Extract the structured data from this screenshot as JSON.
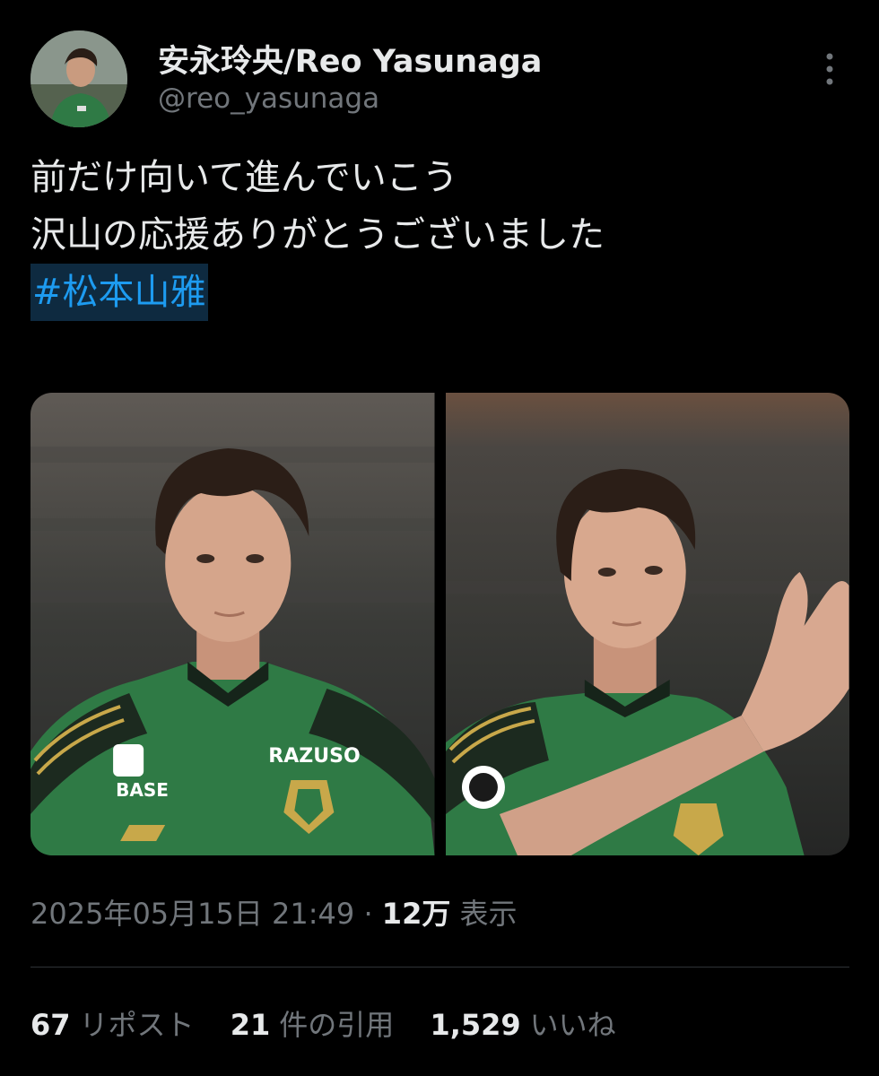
{
  "author": {
    "display_name": "安永玲央/Reo Yasunaga",
    "handle": "@reo_yasunaga",
    "avatar_icon": "profile-photo"
  },
  "more_icon": "more-vertical-icon",
  "tweet": {
    "lines": [
      "前だけ向いて進んでいこう",
      "沢山の応援ありがとうございました"
    ],
    "hashtag": "#松本山雅"
  },
  "media": {
    "count": 2,
    "jersey_sponsors": [
      "BASE",
      "RAZUSO"
    ]
  },
  "meta": {
    "timestamp": "2025年05月15日 21:49",
    "separator": "·",
    "views_count": "12万",
    "views_label": "表示"
  },
  "stats": {
    "reposts_count": "67",
    "reposts_label": "リポスト",
    "quotes_count": "21",
    "quotes_label": "件の引用",
    "likes_count": "1,529",
    "likes_label": "いいね"
  },
  "colors": {
    "background": "#000000",
    "text": "#e7e9ea",
    "muted": "#71767b",
    "link": "#1d9bf0",
    "divider": "#2f3336",
    "jersey_green": "#2f7a45"
  }
}
